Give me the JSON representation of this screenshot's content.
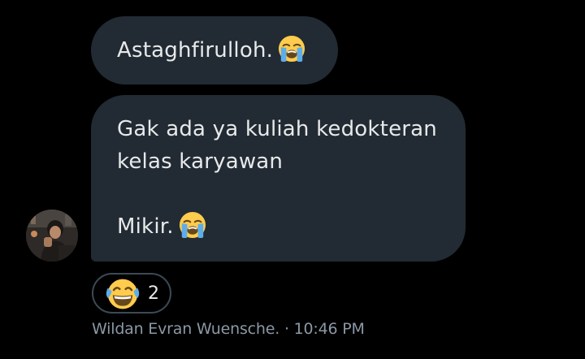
{
  "messages": [
    {
      "lines": [
        "Astaghfirulloh."
      ],
      "emoji": "loudly-crying-face"
    },
    {
      "lines": [
        "Gak ada ya kuliah kedokteran",
        "kelas karyawan",
        "",
        "Mikir."
      ],
      "emoji": "loudly-crying-face"
    }
  ],
  "sender": {
    "name": "Wildan Evran Wuensche.",
    "separator": "·",
    "time": "10:46 PM",
    "avatar": "avatar-photo"
  },
  "reaction": {
    "emoji": "face-with-tears-of-joy",
    "count": "2"
  },
  "colors": {
    "background": "#000000",
    "bubble": "#222b33",
    "text": "#e7e9ea",
    "muted": "#8b98a5",
    "reaction_border": "#3d4a54"
  }
}
